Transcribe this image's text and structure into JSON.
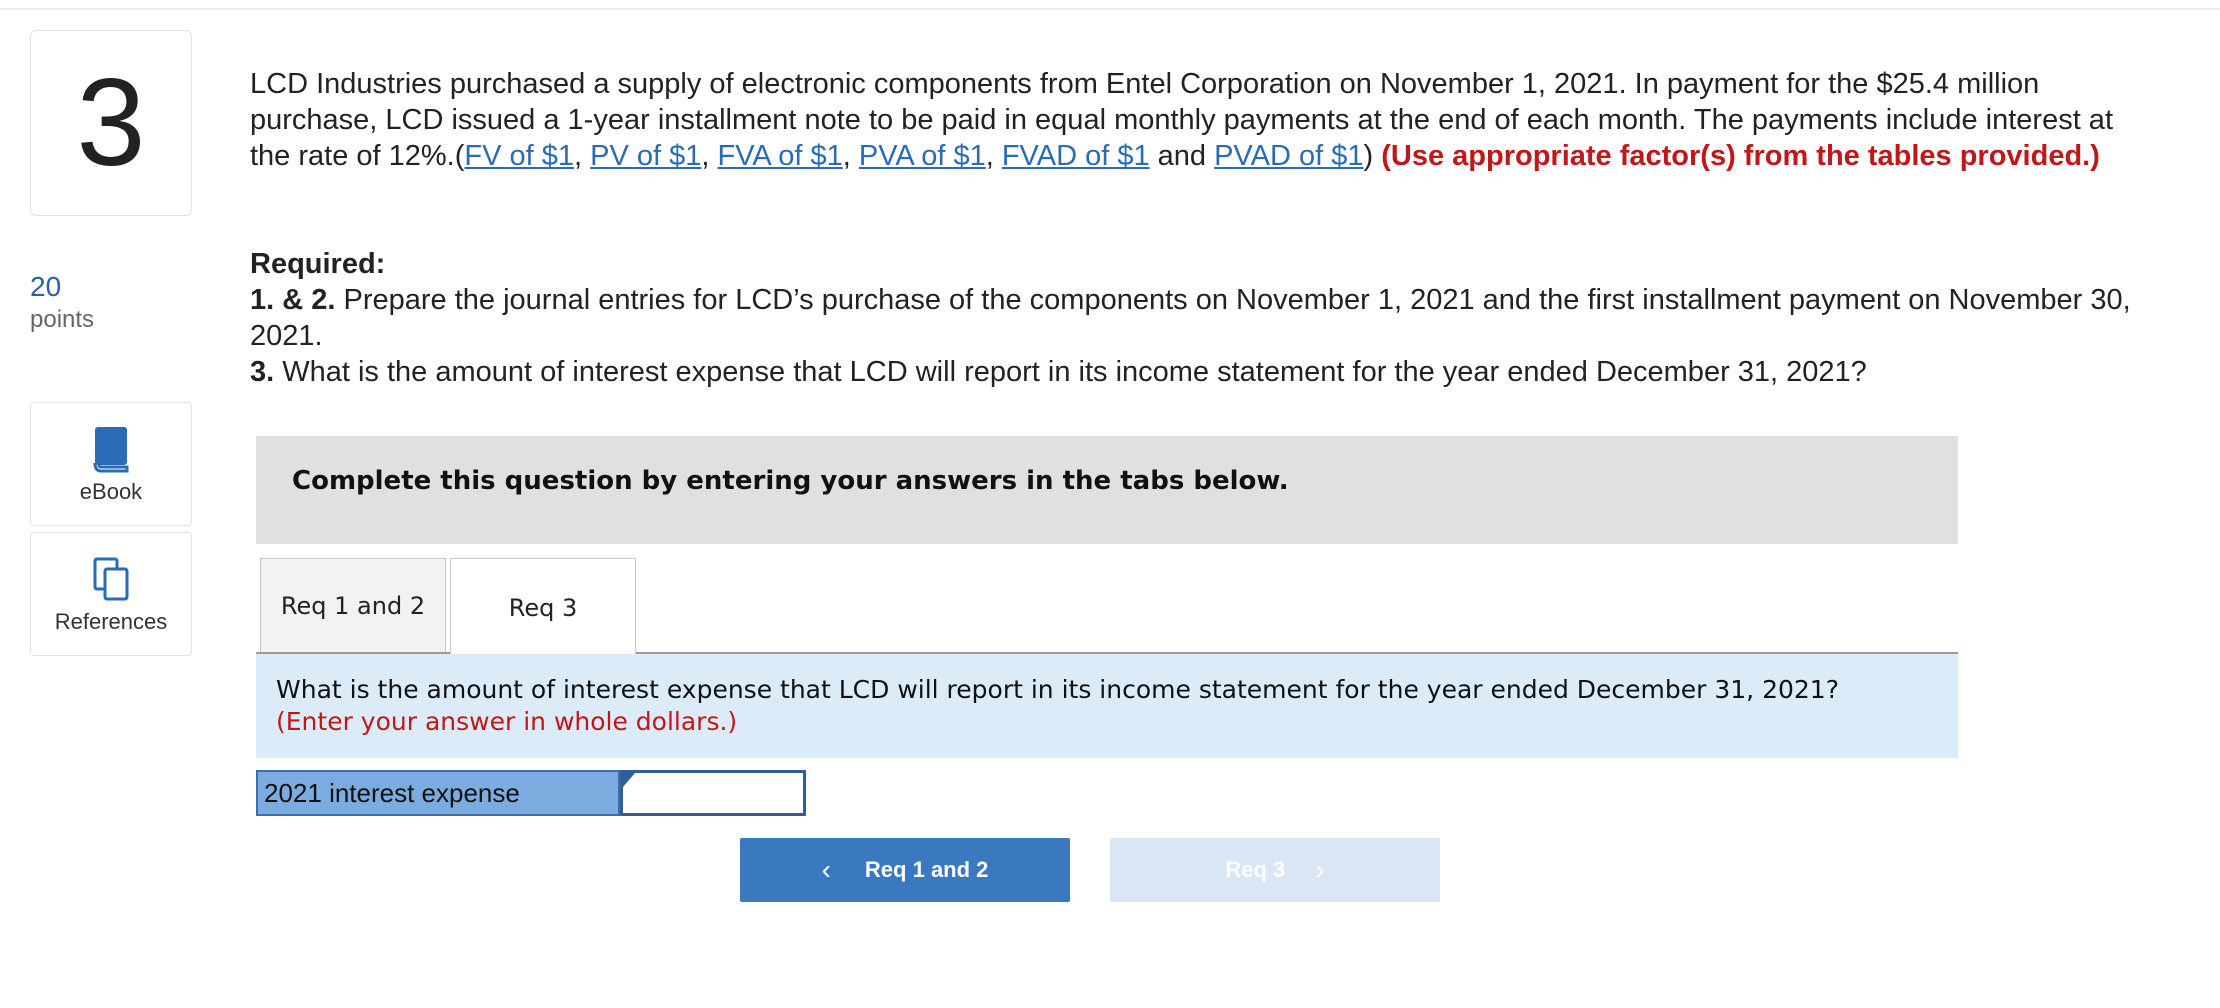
{
  "question_number": "3",
  "points": {
    "value": "20",
    "label": "points"
  },
  "sidebar": {
    "ebook_label": "eBook",
    "references_label": "References"
  },
  "question": {
    "text_part1": "LCD Industries purchased a supply of electronic components from Entel Corporation on November 1, 2021. In payment for the $25.4 million purchase, LCD issued a 1-year installment note to be paid in equal monthly payments at the end of each month. The payments include interest at the rate of 12%.(",
    "links": [
      "FV of $1",
      "PV of $1",
      "FVA of $1",
      "PVA of $1",
      "FVAD of $1",
      "PVAD of $1"
    ],
    "sep_comma": ", ",
    "sep_and": " and ",
    "close_paren": ")",
    "instruction_red": "(Use appropriate factor(s) from the tables provided.)"
  },
  "required": {
    "heading": "Required:",
    "item1_num": "1. & 2.",
    "item1_text": " Prepare the journal entries for LCD’s purchase of the components on November 1, 2021 and the first installment payment on November 30, 2021.",
    "item2_num": "3.",
    "item2_text": " What is the amount of interest expense that LCD will report in its income statement for the year ended December 31, 2021?"
  },
  "instruction_banner": "Complete this question by entering your answers in the tabs below.",
  "tabs": [
    {
      "label": "Req 1 and 2",
      "active": false
    },
    {
      "label": "Req 3",
      "active": true
    }
  ],
  "panel": {
    "question": "What is the amount of interest expense that LCD will report in its income statement for the year ended December 31, 2021?",
    "hint": "(Enter your answer in whole dollars.)"
  },
  "answer": {
    "label": "2021 interest expense",
    "value": ""
  },
  "nav": {
    "prev_label": "Req 1 and 2",
    "next_label": "Req 3",
    "prev_icon": "chevron-left-icon",
    "next_icon": "chevron-right-icon"
  },
  "colors": {
    "link": "#2a6bb5",
    "alert_red": "#c01818",
    "primary_button": "#3a78c0",
    "disabled_button": "#dae6f3",
    "panel_bg": "#dcebf8",
    "label_bg": "#7aace0"
  }
}
